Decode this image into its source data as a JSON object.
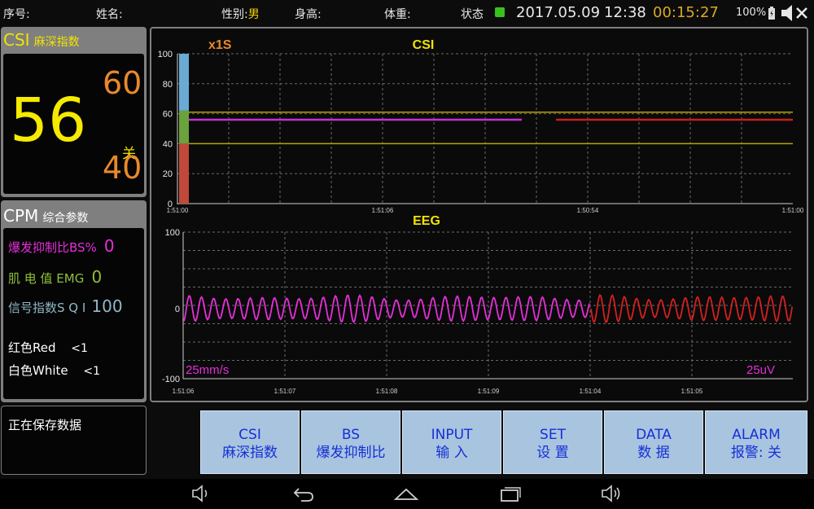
{
  "status_bar": {
    "serial_label": "序号:",
    "name_label": "姓名:",
    "gender_label": "性别:",
    "gender_value": "男",
    "height_label": "身高:",
    "weight_label": "体重:",
    "status_label": "状态",
    "status_color": "#39c21d",
    "date": "2017.05.09",
    "time": "12:38",
    "elapsed": "00:15:27",
    "battery": "100%",
    "elapsed_color": "#d9a72a"
  },
  "csi_panel": {
    "title_big": "CSI",
    "title_small": "麻深指数",
    "value": "56",
    "upper": "60",
    "lower": "40",
    "alarm_state": "关"
  },
  "cpm_panel": {
    "title_big": "CPM",
    "title_small": "综合参数",
    "bs_label": "爆发抑制比BS%",
    "bs_value": "0",
    "emg_label": "肌 电 值 EMG",
    "emg_value": "0",
    "sqi_label": "信号指数S Q I",
    "sqi_value": "100",
    "red_label": "红色Red",
    "red_value": "<1",
    "white_label": "白色White",
    "white_value": "<1"
  },
  "save_panel": {
    "text": "正在保存数据"
  },
  "csi_chart": {
    "title": "CSI",
    "speed": "x1S",
    "y_ticks": [
      "100",
      "80",
      "60",
      "40",
      "20",
      "0"
    ],
    "x_ticks": [
      "1:51:00",
      "1:51:06",
      "1:50:54",
      "1:51:00"
    ],
    "bar_segments": [
      {
        "from": 62,
        "to": 100,
        "color": "#6aaad4"
      },
      {
        "from": 40,
        "to": 62,
        "color": "#6aa23c"
      },
      {
        "from": 0,
        "to": 40,
        "color": "#c0493a"
      }
    ],
    "limit_lines": [
      61,
      40
    ],
    "trend_magenta": 56,
    "trend_red": 56
  },
  "eeg_chart": {
    "title": "EEG",
    "y_ticks": [
      "100",
      "0",
      "-100"
    ],
    "x_ticks": [
      "1:51:06",
      "1:51:07",
      "1:51:08",
      "1:51:09",
      "1:51:04",
      "1:51:05"
    ],
    "sweep_speed": "25mm/s",
    "amplitude": "25uV"
  },
  "buttons": [
    {
      "line1": "CSI",
      "line2": "麻深指数"
    },
    {
      "line1": "BS",
      "line2": "爆发抑制比"
    },
    {
      "line1": "INPUT",
      "line2": "输 入"
    },
    {
      "line1": "SET",
      "line2": "设 置"
    },
    {
      "line1": "DATA",
      "line2": "数 据"
    },
    {
      "line1": "ALARM",
      "line2": "报警: 关"
    }
  ],
  "nav_icons": [
    "volume-down-icon",
    "back-icon",
    "home-icon",
    "recent-apps-icon",
    "volume-up-icon"
  ]
}
